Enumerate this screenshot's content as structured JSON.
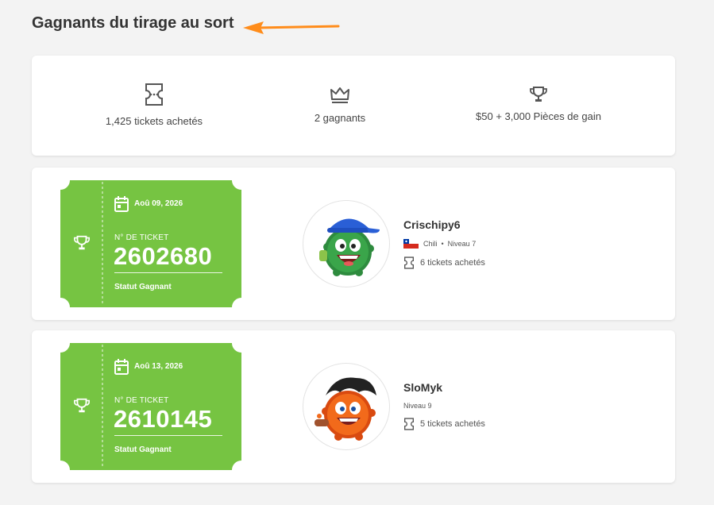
{
  "header": {
    "title": "Gagnants du tirage au sort"
  },
  "stats": [
    {
      "icon": "ticket-icon",
      "label": "1,425 tickets achetés"
    },
    {
      "icon": "crown-icon",
      "label": "2 gagnants"
    },
    {
      "icon": "trophy-icon",
      "label": "$50 + 3,000 Pièces de gain"
    }
  ],
  "winners": [
    {
      "date": "Aoû 09, 2026",
      "ticket_label": "N° DE TICKET",
      "ticket_number": "2602680",
      "status": "Statut Gagnant",
      "username": "Crischipy6",
      "country": "Chili",
      "separator": "•",
      "level": "Niveau 7",
      "tickets": "6 tickets achetés"
    },
    {
      "date": "Aoû 13, 2026",
      "ticket_label": "N° DE TICKET",
      "ticket_number": "2610145",
      "status": "Statut Gagnant",
      "username": "SloMyk",
      "level": "Niveau 9",
      "tickets": "5 tickets achetés"
    }
  ],
  "colors": {
    "ticket_green": "#76c442",
    "arrow_orange": "#ff8c1a"
  }
}
